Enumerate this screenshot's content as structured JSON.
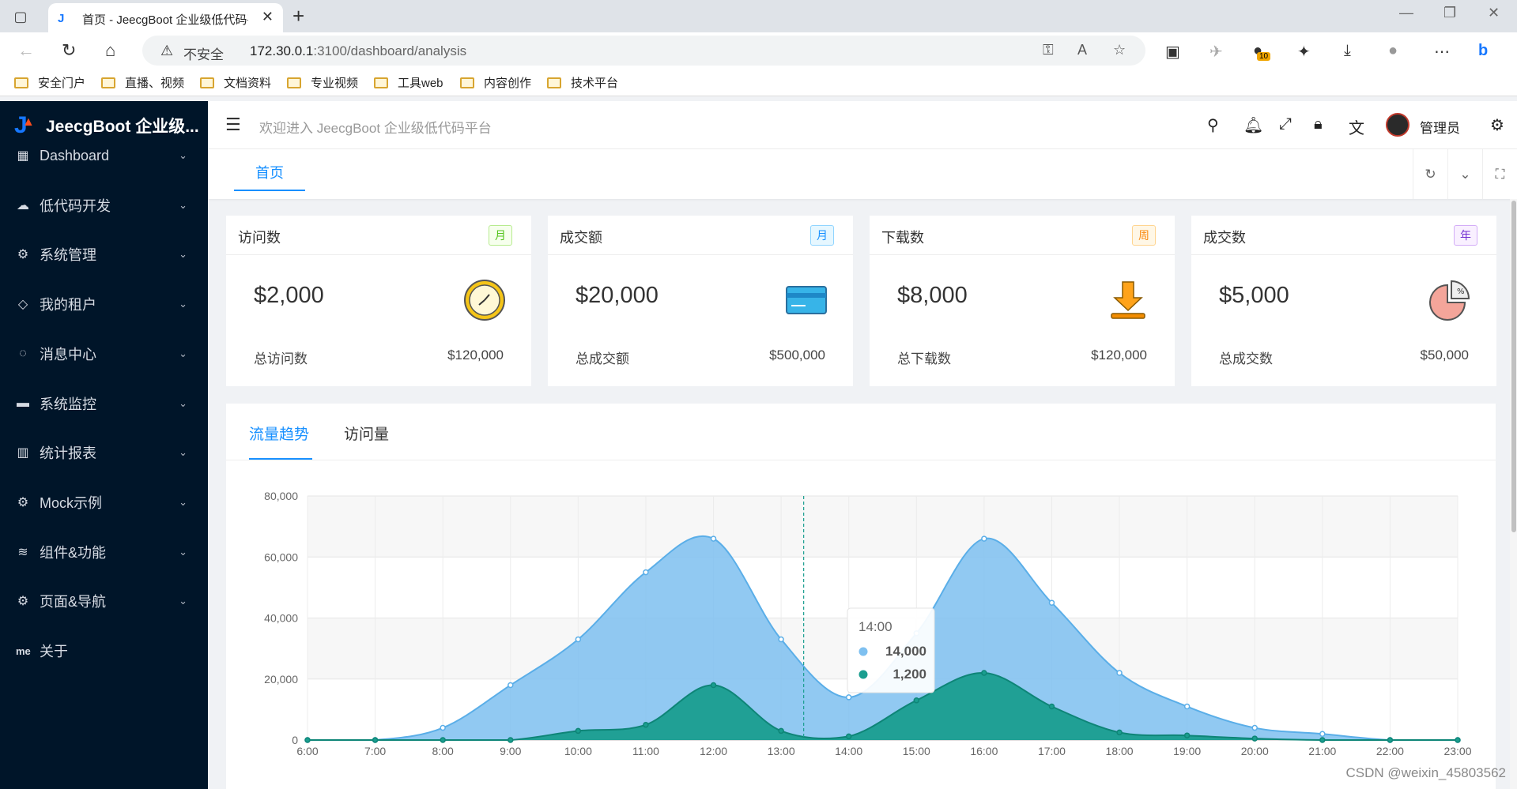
{
  "browser": {
    "tab_title": "首页 - JeecgBoot 企业级低代码平",
    "security_label": "不安全",
    "url_host": "172.30.0.1",
    "url_rest": ":3100/dashboard/analysis",
    "ext_badge": "10",
    "bookmarks": [
      "安全门户",
      "直播、视频",
      "文档资料",
      "专业视频",
      "工具web",
      "内容创作",
      "技术平台"
    ]
  },
  "app": {
    "logo_text": "JeecgBoot 企业级...",
    "welcome": "欢迎进入 JeecgBoot 企业级低代码平台",
    "user_name": "管理员",
    "page_tab": "首页"
  },
  "sidebar": {
    "items": [
      {
        "label": "Dashboard",
        "icon": "dashboard-icon"
      },
      {
        "label": "低代码开发",
        "icon": "cloud-icon"
      },
      {
        "label": "系统管理",
        "icon": "settings-icon"
      },
      {
        "label": "我的租户",
        "icon": "tenant-icon"
      },
      {
        "label": "消息中心",
        "icon": "message-icon"
      },
      {
        "label": "系统监控",
        "icon": "monitor-icon"
      },
      {
        "label": "统计报表",
        "icon": "chart-icon"
      },
      {
        "label": "Mock示例",
        "icon": "settings-icon"
      },
      {
        "label": "组件&功能",
        "icon": "layers-icon"
      },
      {
        "label": "页面&导航",
        "icon": "nav-icon"
      },
      {
        "label": "关于",
        "icon": "me-icon",
        "icon_text": "me"
      }
    ]
  },
  "cards": [
    {
      "title": "访问数",
      "tag": "月",
      "value": "$2,000",
      "foot_label": "总访问数",
      "foot_value": "$120,000",
      "tag_color": "#52c41a",
      "tag_bg": "#f6ffed",
      "icon": "clock-icon"
    },
    {
      "title": "成交额",
      "tag": "月",
      "value": "$20,000",
      "foot_label": "总成交额",
      "foot_value": "$500,000",
      "tag_color": "#1890ff",
      "tag_bg": "#e6f7ff",
      "icon": "credit-card-icon"
    },
    {
      "title": "下载数",
      "tag": "周",
      "value": "$8,000",
      "foot_label": "总下载数",
      "foot_value": "$120,000",
      "tag_color": "#fa8c16",
      "tag_bg": "#fff7e6",
      "icon": "download-icon"
    },
    {
      "title": "成交数",
      "tag": "年",
      "value": "$5,000",
      "foot_label": "总成交数",
      "foot_value": "$50,000",
      "tag_color": "#722ed1",
      "tag_bg": "#f9f0ff",
      "icon": "pie-chart-icon"
    }
  ],
  "chart_tabs": [
    "流量趋势",
    "访问量"
  ],
  "tooltip": {
    "time": "14:00",
    "v1": "14,000",
    "v2": "1,200"
  },
  "watermark": "CSDN @weixin_45803562",
  "colors": {
    "series1": "#7ec0f0",
    "series2": "#1a9e8f",
    "accent": "#1890ff",
    "sidebar": "#001529"
  },
  "chart_data": {
    "type": "area",
    "x": [
      "6:00",
      "7:00",
      "8:00",
      "9:00",
      "10:00",
      "11:00",
      "12:00",
      "13:00",
      "14:00",
      "15:00",
      "16:00",
      "17:00",
      "18:00",
      "19:00",
      "20:00",
      "21:00",
      "22:00",
      "23:00"
    ],
    "series": [
      {
        "values": [
          0,
          0,
          4000,
          18000,
          33000,
          55000,
          66000,
          33000,
          14000,
          35000,
          66000,
          45000,
          22000,
          11000,
          4000,
          2000,
          0,
          0
        ]
      },
      {
        "values": [
          0,
          0,
          0,
          0,
          3000,
          5000,
          18000,
          3000,
          1200,
          13000,
          22000,
          11000,
          2500,
          1500,
          500,
          0,
          0,
          0
        ]
      }
    ],
    "ylim": [
      0,
      80000
    ],
    "yticks": [
      "0",
      "20,000",
      "40,000",
      "60,000",
      "80,000"
    ],
    "grid": true,
    "tooltip_x": "13:20"
  }
}
